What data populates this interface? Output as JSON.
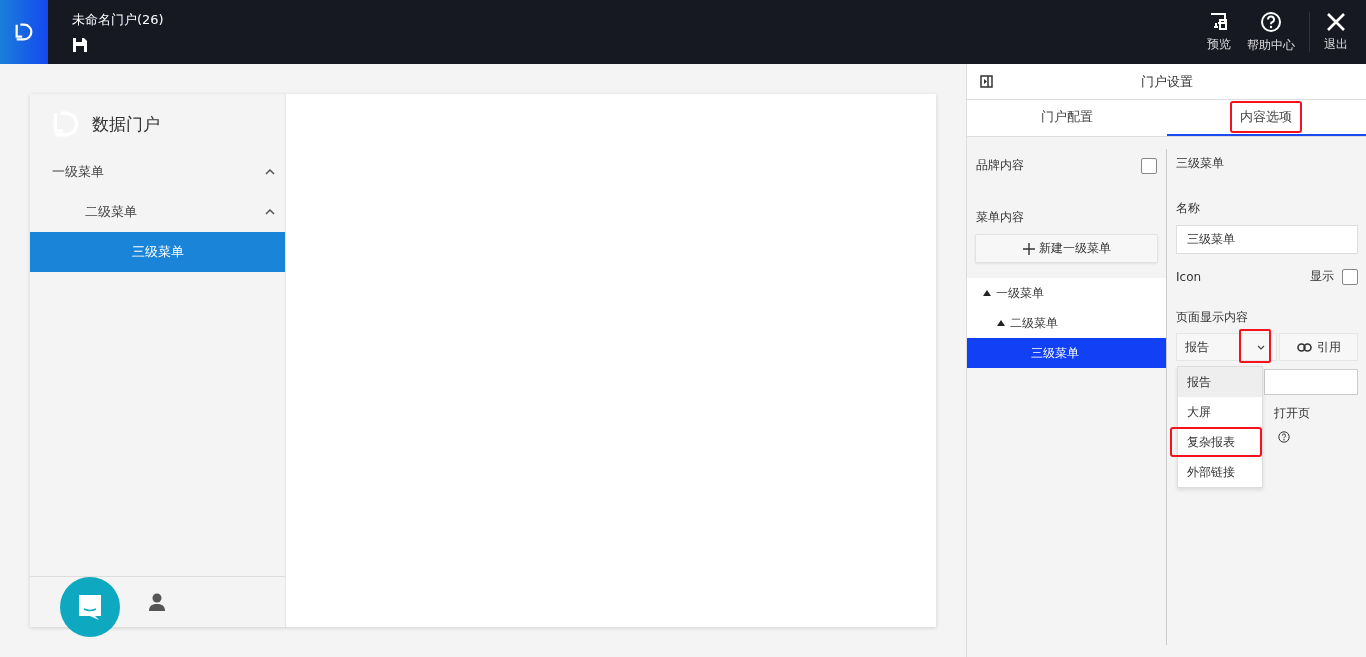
{
  "topbar": {
    "title": "未命名门户(26)",
    "actions": [
      {
        "label": "预览",
        "kind": "monitor"
      },
      {
        "label": "帮助中心",
        "kind": "help"
      },
      {
        "label": "退出",
        "kind": "close"
      }
    ]
  },
  "preview": {
    "brand": "数据门户",
    "menu": [
      {
        "label": "一级菜单",
        "expanded": true,
        "selected": false,
        "children": [
          {
            "label": "二级菜单",
            "expanded": true,
            "selected": false,
            "children": [
              {
                "label": "三级菜单",
                "selected": true
              }
            ]
          }
        ]
      }
    ]
  },
  "settings": {
    "title": "门户设置",
    "tabs": [
      {
        "label": "门户配置",
        "selected": false,
        "highlighted": false
      },
      {
        "label": "内容选项",
        "selected": true,
        "highlighted": true
      }
    ],
    "brand_content": {
      "label": "品牌内容",
      "checked": false
    },
    "menu_content": {
      "label": "菜单内容",
      "add_button": "新建一级菜单",
      "tree": [
        {
          "label": "一级菜单",
          "expanded": true,
          "selected": false,
          "children": [
            {
              "label": "二级菜单",
              "expanded": true,
              "selected": false,
              "children": [
                {
                  "label": "三级菜单",
                  "selected": true
                }
              ]
            }
          ]
        }
      ]
    },
    "detail": {
      "heading": "三级菜单",
      "name_label": "名称",
      "name_value": "三级菜单",
      "icon_label": "Icon",
      "show_label": "显示",
      "show_checked": false,
      "page_content_label": "页面显示内容",
      "content_type": "报告",
      "caret_highlighted": true,
      "link_button": "引用",
      "hidden_row_text": "打开页",
      "dropdown": [
        {
          "label": "报告",
          "selected": true,
          "highlighted": false
        },
        {
          "label": "大屏",
          "selected": false,
          "highlighted": false
        },
        {
          "label": "复杂报表",
          "selected": false,
          "highlighted": true
        },
        {
          "label": "外部链接",
          "selected": false,
          "highlighted": false
        }
      ]
    }
  }
}
